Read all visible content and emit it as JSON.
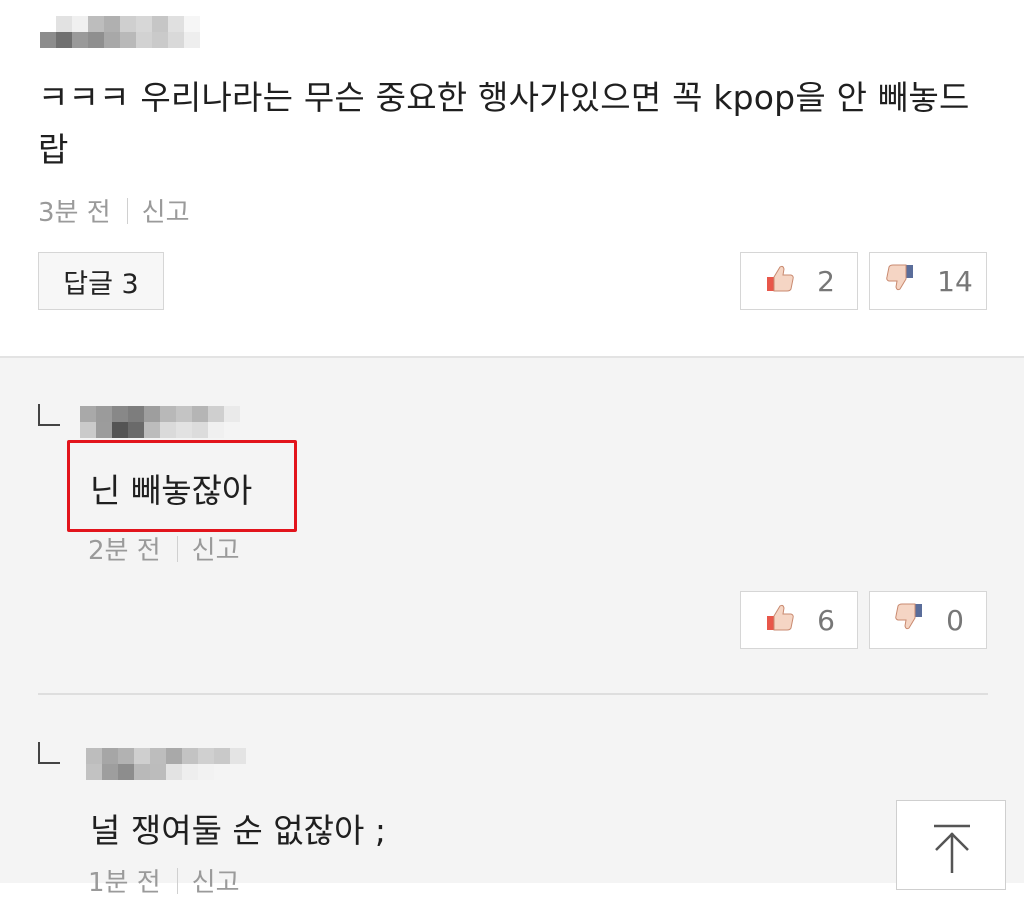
{
  "comment": {
    "text": "ㅋㅋㅋ 우리나라는 무슨 중요한 행사가있으면 꼭 kpop을 안 빼놓드랍",
    "time": "3분 전",
    "report": "신고",
    "reply_label": "답글 3",
    "likes": "2",
    "dislikes": "14"
  },
  "replies": [
    {
      "text": "닌 빼놓잖아",
      "time": "2분 전",
      "report": "신고",
      "likes": "6",
      "dislikes": "0"
    },
    {
      "text": "널 쟁여둘 순 없잖아 ;",
      "time": "1분 전",
      "report": "신고"
    }
  ],
  "icons": {
    "like": "thumbs-up-icon",
    "dislike": "thumbs-down-icon",
    "scroll_top": "arrow-up-icon"
  },
  "colors": {
    "highlight": "#e2141c",
    "reply_bg": "#f4f4f4"
  }
}
